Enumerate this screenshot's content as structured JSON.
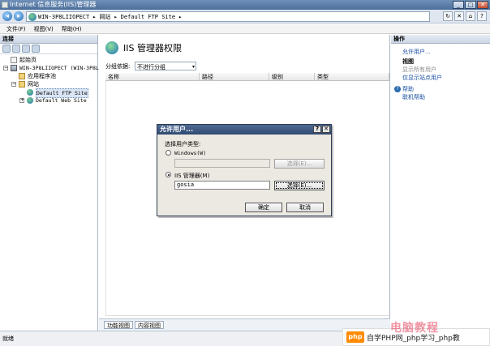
{
  "window": {
    "title": "Internet 信息服务(IIS)管理器"
  },
  "address": {
    "segments": [
      "WIN-3P8LIIOPECT",
      "▸",
      "网站",
      "▸",
      "Default FTP Site",
      "▸"
    ]
  },
  "menu": {
    "items": [
      "文件(F)",
      "视图(V)",
      "帮助(H)"
    ]
  },
  "connections": {
    "title": "连接",
    "tree": [
      {
        "label": "起始页",
        "icon": "page",
        "indent": 0,
        "toggle": ""
      },
      {
        "label": "WIN-3P8LIIOPECT (WIN-3P8LI",
        "icon": "server",
        "indent": 0,
        "toggle": "−"
      },
      {
        "label": "应用程序池",
        "icon": "folder",
        "indent": 1,
        "toggle": ""
      },
      {
        "label": "网站",
        "icon": "folder",
        "indent": 1,
        "toggle": "−"
      },
      {
        "label": "Default FTP Site",
        "icon": "globe",
        "indent": 2,
        "toggle": "",
        "selected": true
      },
      {
        "label": "Default Web Site",
        "icon": "globe",
        "indent": 2,
        "toggle": "+"
      }
    ]
  },
  "content": {
    "title": "IIS 管理器权限",
    "group_label": "分组依据:",
    "group_value": "不进行分组",
    "columns": [
      "名称",
      "路径",
      "级别",
      "类型"
    ],
    "tabs": [
      "功能视图",
      "内容视图"
    ]
  },
  "actions": {
    "title": "操作",
    "allow_users": "允许用户...",
    "view_header": "视图",
    "show_all_users": "显示所有用户",
    "show_site_users": "仅显示站点用户",
    "help": "帮助",
    "online_help": "联机帮助"
  },
  "status": {
    "text": "就绪"
  },
  "watermark": {
    "text": "自学PHP网_php学习_php教",
    "logo": "php"
  },
  "dialog": {
    "title": "允许用户...",
    "help_btn": "?",
    "close_btn": "✕",
    "type_label": "选择用户类型:",
    "windows_option": "Windows(W)",
    "windows_value": "",
    "select_windows": "选择(E)...",
    "iis_option": "IIS 管理器(M)",
    "iis_value": "gosia",
    "select_iis": "选择(E)...",
    "ok": "确定",
    "cancel": "取消"
  }
}
